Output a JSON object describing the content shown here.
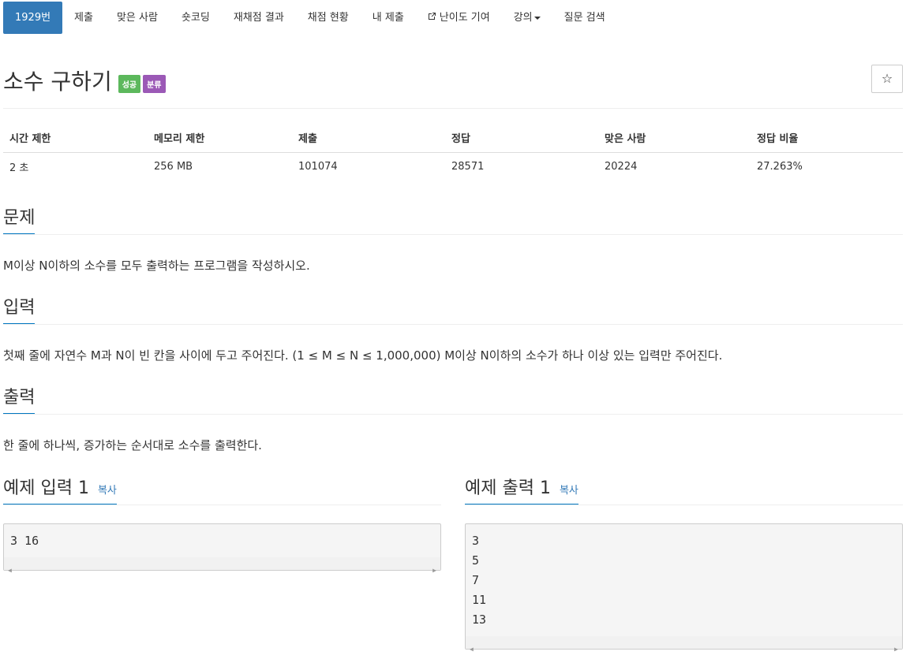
{
  "nav": {
    "items": [
      {
        "label": "1929번",
        "active": true
      },
      {
        "label": "제출"
      },
      {
        "label": "맞은 사람"
      },
      {
        "label": "숏코딩"
      },
      {
        "label": "재채점 결과"
      },
      {
        "label": "채점 현황"
      },
      {
        "label": "내 제출"
      },
      {
        "label": "난이도 기여",
        "icon": "external-link-icon"
      },
      {
        "label": "강의",
        "icon": "caret-down-icon"
      },
      {
        "label": "질문 검색"
      }
    ]
  },
  "problem": {
    "title": "소수 구하기",
    "badges": [
      "성공",
      "분류"
    ],
    "star_icon": "☆"
  },
  "info_table": {
    "headers": [
      "시간 제한",
      "메모리 제한",
      "제출",
      "정답",
      "맞은 사람",
      "정답 비율"
    ],
    "values": [
      "2 초",
      "256 MB",
      "101074",
      "28571",
      "20224",
      "27.263%"
    ]
  },
  "sections": {
    "problem": {
      "heading": "문제",
      "body": "M이상 N이하의 소수를 모두 출력하는 프로그램을 작성하시오."
    },
    "input": {
      "heading": "입력",
      "body": "첫째 줄에 자연수 M과 N이 빈 칸을 사이에 두고 주어진다. (1 ≤ M ≤ N ≤ 1,000,000) M이상 N이하의 소수가 하나 이상 있는 입력만 주어진다."
    },
    "output": {
      "heading": "출력",
      "body": "한 줄에 하나씩, 증가하는 순서대로 소수를 출력한다."
    }
  },
  "samples": {
    "input": {
      "heading": "예제 입력 1",
      "copy": "복사",
      "lines": [
        "3 16"
      ]
    },
    "output": {
      "heading": "예제 출력 1",
      "copy": "복사",
      "lines": [
        "3",
        "5",
        "7",
        "11",
        "13"
      ]
    }
  },
  "colors": {
    "accent": "#337ab7",
    "success": "#5cb85c",
    "purple": "#9b59b6"
  }
}
